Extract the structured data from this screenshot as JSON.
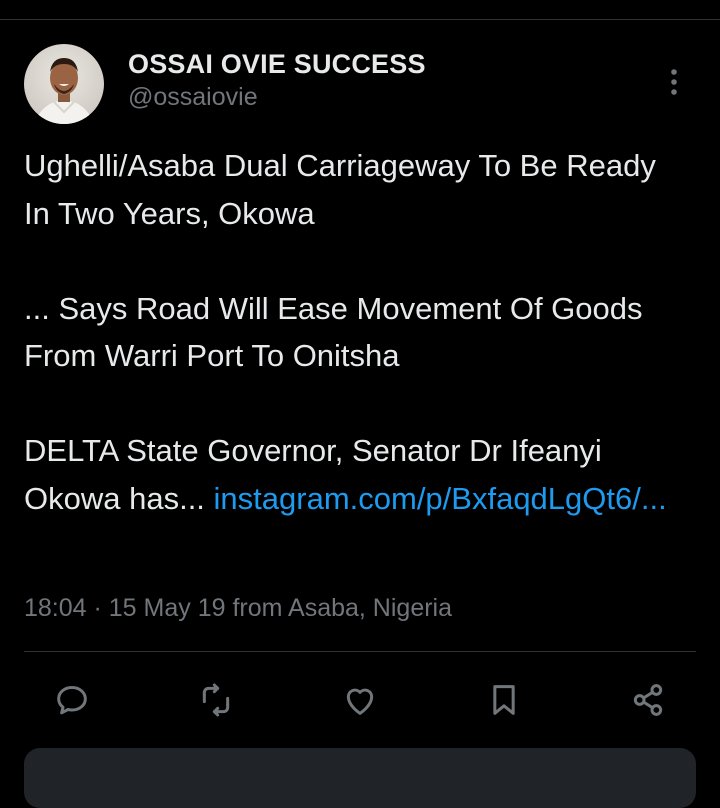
{
  "user": {
    "display_name": "OSSAI OVIE SUCCESS",
    "handle": "@ossaiovie"
  },
  "tweet": {
    "line1": "Ughelli/Asaba Dual Carriageway To Be Ready In Two Years, Okowa",
    "line2": "... Says Road Will Ease Movement Of Goods From Warri Port To Onitsha",
    "line3_text": "DELTA State Governor, Senator Dr Ifeanyi Okowa has... ",
    "line3_link": "instagram.com/p/BxfaqdLgQt6/..."
  },
  "meta": {
    "timestamp": "18:04 · 15 May 19 from Asaba, Nigeria"
  },
  "actions": [
    {
      "name": "reply",
      "icon": "comment-icon"
    },
    {
      "name": "retweet",
      "icon": "retweet-icon"
    },
    {
      "name": "like",
      "icon": "heart-icon"
    },
    {
      "name": "bookmark",
      "icon": "bookmark-icon"
    },
    {
      "name": "share",
      "icon": "share-icon"
    }
  ],
  "colors": {
    "background": "#000000",
    "text": "#e7e9ea",
    "secondary": "#71767b",
    "link": "#1d9bf0",
    "divider": "#2f3336"
  }
}
